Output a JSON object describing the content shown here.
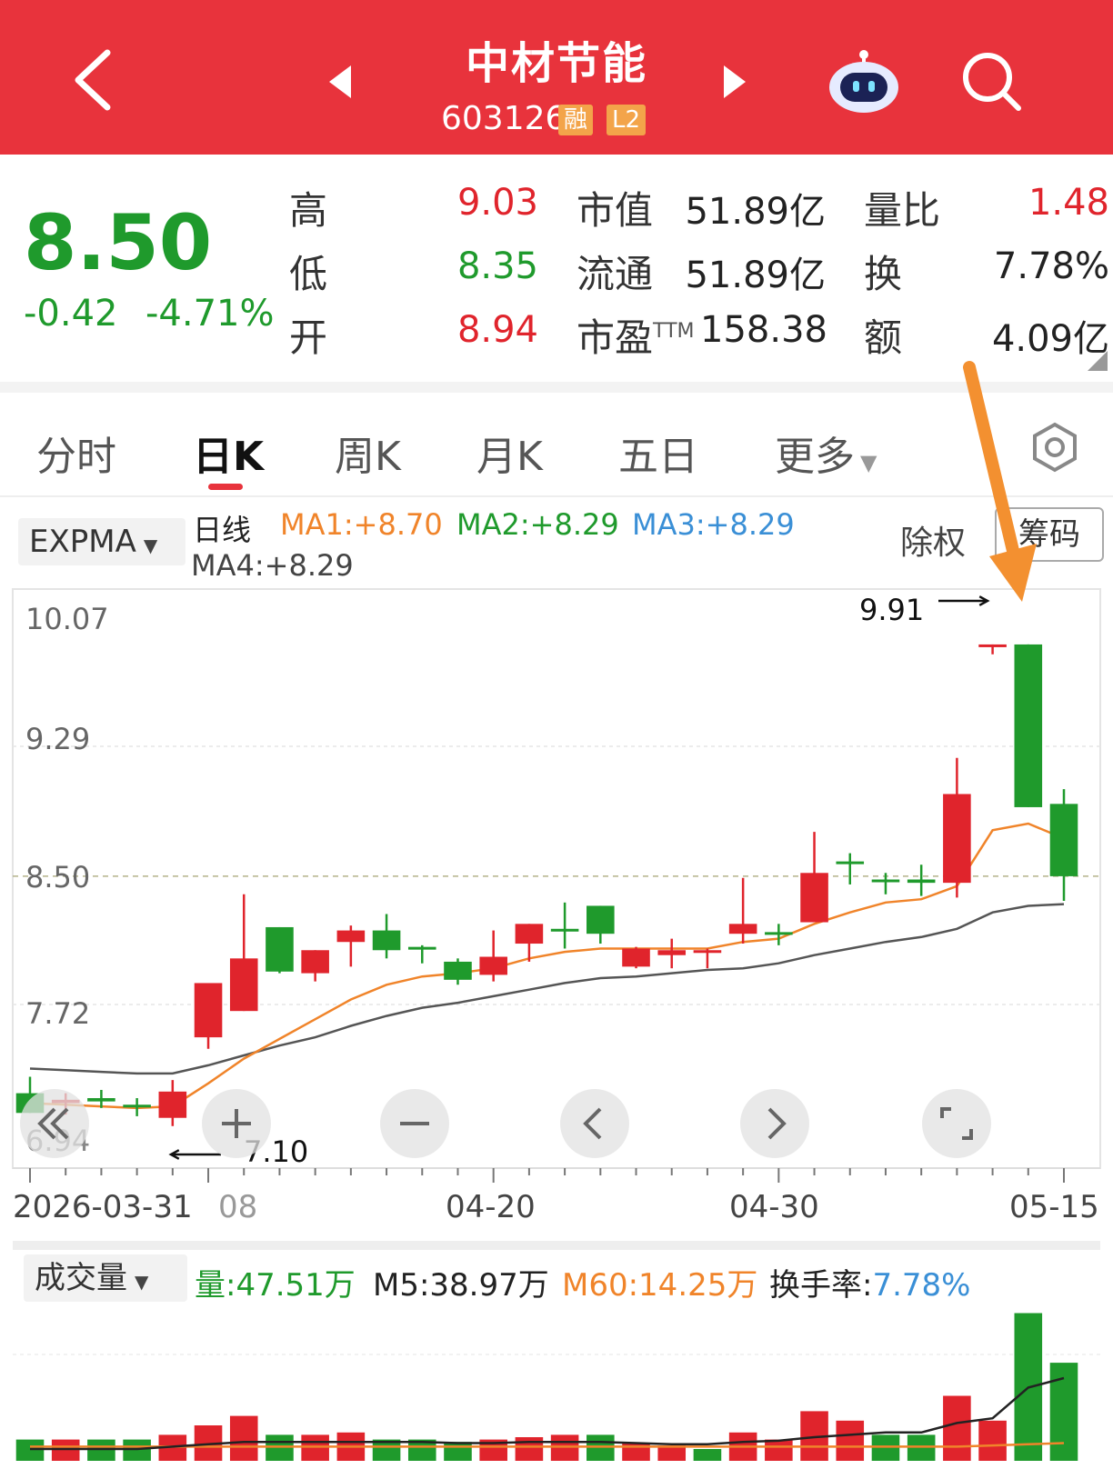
{
  "header": {
    "title": "中材节能",
    "code": "603126",
    "tag_margin": "融",
    "tag_level": "L2"
  },
  "quote": {
    "price": "8.50",
    "change": "-0.42",
    "change_pct": "-4.71%",
    "high_label": "高",
    "high": "9.03",
    "low_label": "低",
    "low": "8.35",
    "open_label": "开",
    "open": "8.94",
    "mktcap_label": "市值",
    "mktcap": "51.89亿",
    "float_label": "流通",
    "float": "51.89亿",
    "pe_label": "市盈",
    "pe_sup": "TTM",
    "pe": "158.38",
    "volratio_label": "量比",
    "volratio": "1.48",
    "turnover_label": "换",
    "turnover": "7.78%",
    "amount_label": "额",
    "amount": "4.09亿"
  },
  "tabs": [
    {
      "label": "分时"
    },
    {
      "label": "日K"
    },
    {
      "label": "周K"
    },
    {
      "label": "月K"
    },
    {
      "label": "五日"
    },
    {
      "label": "更多"
    }
  ],
  "indicator": {
    "selector": "EXPMA",
    "period": "日线",
    "ma1": "MA1:+8.70",
    "ma2": "MA2:+8.29",
    "ma3": "MA3:+8.29",
    "ma4": "MA4:+8.29",
    "exright": "除权",
    "chips_btn": "筹码"
  },
  "annotations": {
    "high_mark": "9.91",
    "low_mark": "7.10"
  },
  "x_axis_labels": [
    "2026-03-31",
    "08",
    "04-20",
    "04-30",
    "05-15"
  ],
  "volume": {
    "selector": "成交量",
    "vol": "量:47.51万",
    "m5": "M5:38.97万",
    "m60": "M60:14.25万",
    "turnover_label": "换手率:",
    "turnover": "7.78%"
  },
  "colors": {
    "up": "#e0242c",
    "down": "#1f9a2c",
    "ma_orange": "#f0842a",
    "ma_gray": "#555555",
    "header_bg": "#e8333c",
    "arrow": "#f39030"
  },
  "chart_data": {
    "type": "candlestick",
    "y_ticks": [
      "10.07",
      "9.29",
      "8.50",
      "7.72",
      "6.94"
    ],
    "ylim": [
      6.94,
      10.07
    ],
    "current_price_line": 8.5,
    "candles": [
      {
        "o": 7.18,
        "h": 7.28,
        "l": 7.06,
        "c": 7.06
      },
      {
        "o": 7.12,
        "h": 7.18,
        "l": 7.05,
        "c": 7.14
      },
      {
        "o": 7.15,
        "h": 7.2,
        "l": 7.09,
        "c": 7.13
      },
      {
        "o": 7.11,
        "h": 7.15,
        "l": 7.04,
        "c": 7.1
      },
      {
        "o": 7.03,
        "h": 7.26,
        "l": 6.98,
        "c": 7.19
      },
      {
        "o": 7.52,
        "h": 7.85,
        "l": 7.45,
        "c": 7.85
      },
      {
        "o": 7.68,
        "h": 8.39,
        "l": 7.68,
        "c": 8.0
      },
      {
        "o": 8.19,
        "h": 8.19,
        "l": 7.91,
        "c": 7.92
      },
      {
        "o": 7.91,
        "h": 8.05,
        "l": 7.86,
        "c": 8.05
      },
      {
        "o": 8.1,
        "h": 8.2,
        "l": 7.95,
        "c": 8.17
      },
      {
        "o": 8.17,
        "h": 8.27,
        "l": 8.0,
        "c": 8.05
      },
      {
        "o": 8.07,
        "h": 8.08,
        "l": 7.97,
        "c": 8.07
      },
      {
        "o": 7.98,
        "h": 8.0,
        "l": 7.84,
        "c": 7.87
      },
      {
        "o": 7.9,
        "h": 8.17,
        "l": 7.86,
        "c": 8.01
      },
      {
        "o": 8.09,
        "h": 8.21,
        "l": 7.98,
        "c": 8.21
      },
      {
        "o": 8.18,
        "h": 8.34,
        "l": 8.06,
        "c": 8.18
      },
      {
        "o": 8.32,
        "h": 8.32,
        "l": 8.09,
        "c": 8.15
      },
      {
        "o": 7.95,
        "h": 8.07,
        "l": 7.94,
        "c": 8.06
      },
      {
        "o": 8.02,
        "h": 8.12,
        "l": 7.94,
        "c": 8.05
      },
      {
        "o": 8.04,
        "h": 8.06,
        "l": 7.94,
        "c": 8.05
      },
      {
        "o": 8.15,
        "h": 8.49,
        "l": 8.09,
        "c": 8.21
      },
      {
        "o": 8.16,
        "h": 8.21,
        "l": 8.08,
        "c": 8.16
      },
      {
        "o": 8.22,
        "h": 8.77,
        "l": 8.22,
        "c": 8.52
      },
      {
        "o": 8.59,
        "h": 8.64,
        "l": 8.45,
        "c": 8.59
      },
      {
        "o": 8.48,
        "h": 8.52,
        "l": 8.39,
        "c": 8.48
      },
      {
        "o": 8.48,
        "h": 8.57,
        "l": 8.38,
        "c": 8.46
      },
      {
        "o": 8.46,
        "h": 9.22,
        "l": 8.37,
        "c": 9.0
      },
      {
        "o": 9.91,
        "h": 9.91,
        "l": 9.85,
        "c": 9.91
      },
      {
        "o": 9.91,
        "h": 9.91,
        "l": 8.92,
        "c": 8.92
      },
      {
        "o": 8.94,
        "h": 9.03,
        "l": 8.35,
        "c": 8.5
      }
    ],
    "ma_orange": [
      7.12,
      7.11,
      7.1,
      7.09,
      7.1,
      7.24,
      7.39,
      7.51,
      7.63,
      7.75,
      7.84,
      7.89,
      7.91,
      7.94,
      8.0,
      8.04,
      8.06,
      8.06,
      8.06,
      8.06,
      8.1,
      8.12,
      8.21,
      8.28,
      8.34,
      8.36,
      8.44,
      8.78,
      8.82,
      8.73
    ],
    "ma_gray": [
      7.33,
      7.32,
      7.31,
      7.3,
      7.3,
      7.35,
      7.41,
      7.47,
      7.52,
      7.59,
      7.65,
      7.7,
      7.73,
      7.77,
      7.81,
      7.85,
      7.88,
      7.89,
      7.91,
      7.93,
      7.94,
      7.97,
      8.02,
      8.06,
      8.1,
      8.13,
      8.18,
      8.28,
      8.32,
      8.33
    ],
    "volume_bars": [
      {
        "v": 0.18,
        "up": false
      },
      {
        "v": 0.18,
        "up": true
      },
      {
        "v": 0.18,
        "up": false
      },
      {
        "v": 0.18,
        "up": false
      },
      {
        "v": 0.22,
        "up": true
      },
      {
        "v": 0.3,
        "up": true
      },
      {
        "v": 0.38,
        "up": true
      },
      {
        "v": 0.22,
        "up": false
      },
      {
        "v": 0.22,
        "up": true
      },
      {
        "v": 0.24,
        "up": true
      },
      {
        "v": 0.18,
        "up": false
      },
      {
        "v": 0.18,
        "up": false
      },
      {
        "v": 0.16,
        "up": false
      },
      {
        "v": 0.18,
        "up": true
      },
      {
        "v": 0.2,
        "up": true
      },
      {
        "v": 0.22,
        "up": true
      },
      {
        "v": 0.22,
        "up": false
      },
      {
        "v": 0.15,
        "up": true
      },
      {
        "v": 0.13,
        "up": true
      },
      {
        "v": 0.1,
        "up": false
      },
      {
        "v": 0.24,
        "up": true
      },
      {
        "v": 0.18,
        "up": true
      },
      {
        "v": 0.42,
        "up": true
      },
      {
        "v": 0.34,
        "up": true
      },
      {
        "v": 0.22,
        "up": false
      },
      {
        "v": 0.22,
        "up": false
      },
      {
        "v": 0.55,
        "up": true
      },
      {
        "v": 0.34,
        "up": true
      },
      {
        "v": 1.25,
        "up": false
      },
      {
        "v": 0.83,
        "up": false
      }
    ],
    "vol_ma_dark": [
      0.1,
      0.1,
      0.1,
      0.1,
      0.12,
      0.14,
      0.16,
      0.16,
      0.16,
      0.16,
      0.16,
      0.16,
      0.15,
      0.15,
      0.16,
      0.16,
      0.16,
      0.15,
      0.14,
      0.14,
      0.16,
      0.17,
      0.2,
      0.22,
      0.24,
      0.24,
      0.32,
      0.36,
      0.62,
      0.7
    ],
    "vol_ma_orange": [
      0.12,
      0.12,
      0.12,
      0.12,
      0.12,
      0.12,
      0.12,
      0.12,
      0.12,
      0.12,
      0.12,
      0.12,
      0.12,
      0.12,
      0.12,
      0.12,
      0.12,
      0.12,
      0.12,
      0.12,
      0.12,
      0.12,
      0.12,
      0.12,
      0.12,
      0.12,
      0.12,
      0.13,
      0.14,
      0.15
    ]
  }
}
